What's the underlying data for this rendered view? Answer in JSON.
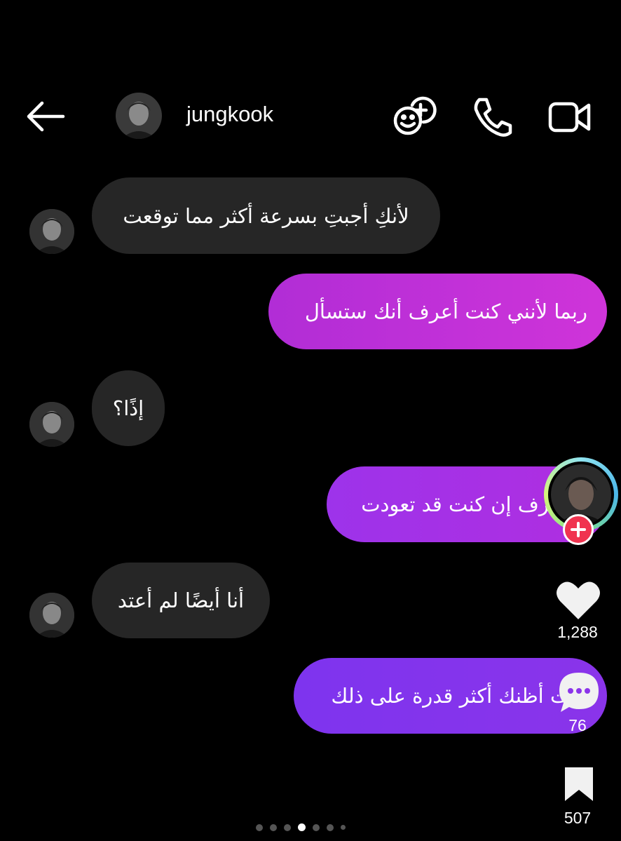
{
  "header": {
    "contact_name": "jungkook",
    "icons": [
      "back-arrow-icon",
      "avatar",
      "effects-add-icon",
      "phone-icon",
      "video-camera-icon"
    ]
  },
  "messages": [
    {
      "direction": "incoming",
      "text": "لأنكِ أجبتِ بسرعة أكثر مما توقعت"
    },
    {
      "direction": "outgoing",
      "text": "ربما لأنني كنت أعرف أنك ستسأل"
    },
    {
      "direction": "incoming",
      "text": "إذًا؟"
    },
    {
      "direction": "outgoing",
      "text": "لا أعرف إن كنت قد تعودت"
    },
    {
      "direction": "incoming",
      "text": "أنا أيضًا لم أعتد"
    },
    {
      "direction": "outgoing",
      "text": "كنت أظنك أكثر قدرة على ذلك"
    }
  ],
  "rail": {
    "likes": "1,288",
    "comments": "76",
    "saves": "507"
  },
  "colors": {
    "incoming_bubble": "#262626",
    "outgoing_gradient": [
      "#8a3bf0",
      "#c22fd4"
    ],
    "follow_badge": "#f0334f"
  },
  "carousel": {
    "total": 7,
    "active": 4
  }
}
